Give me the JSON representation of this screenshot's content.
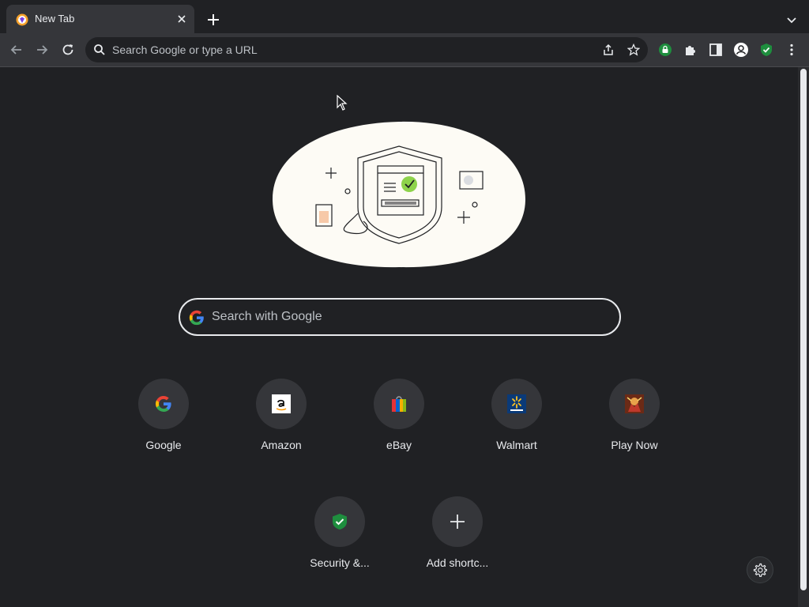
{
  "tab": {
    "title": "New Tab"
  },
  "omnibox": {
    "placeholder": "Search Google or type a URL"
  },
  "search": {
    "placeholder": "Search with Google"
  },
  "shortcuts": [
    {
      "label": "Google"
    },
    {
      "label": "Amazon"
    },
    {
      "label": "eBay"
    },
    {
      "label": "Walmart"
    },
    {
      "label": "Play Now"
    },
    {
      "label": "Security &..."
    },
    {
      "label": "Add shortc..."
    }
  ],
  "colors": {
    "background": "#202124",
    "toolbar": "#35363a",
    "text": "#e8eaed",
    "accent_green": "#1e8e3e"
  }
}
